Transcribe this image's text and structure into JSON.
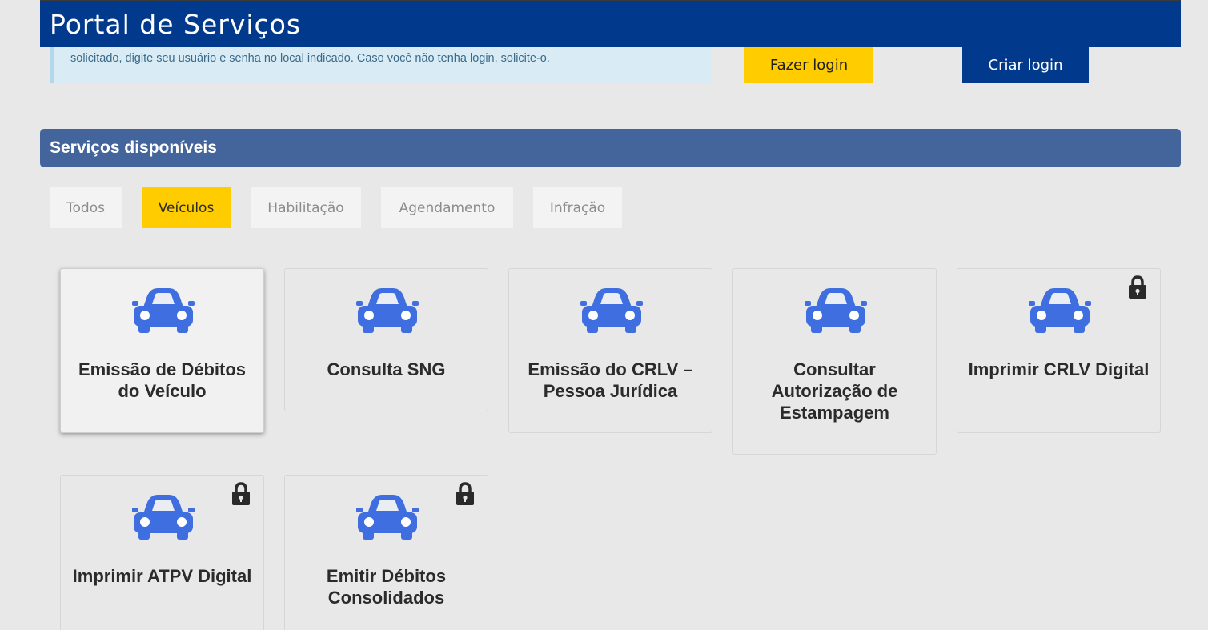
{
  "header": {
    "title": "Portal de Serviços"
  },
  "info": {
    "text": "solicitado, digite seu usuário e senha no local indicado. Caso você não tenha login, solicite-o."
  },
  "actions": {
    "login_label": "Fazer login",
    "create_label": "Criar login"
  },
  "section": {
    "title": "Serviços disponíveis"
  },
  "tabs": [
    {
      "label": "Todos"
    },
    {
      "label": "Veículos",
      "active": true
    },
    {
      "label": "Habilitação"
    },
    {
      "label": "Agendamento"
    },
    {
      "label": "Infração"
    }
  ],
  "cards": [
    {
      "title": "Emissão de Débitos do Veículo",
      "icon": "car-icon",
      "locked": false
    },
    {
      "title": "Consulta SNG",
      "icon": "car-icon",
      "locked": false
    },
    {
      "title": "Emissão do CRLV – Pessoa Jurídica",
      "icon": "car-icon",
      "locked": false
    },
    {
      "title": "Consultar Autorização de Estampagem",
      "icon": "car-icon",
      "locked": false
    },
    {
      "title": "Imprimir CRLV Digital",
      "icon": "car-icon",
      "locked": true
    },
    {
      "title": "Imprimir ATPV Digital",
      "icon": "car-icon",
      "locked": true
    },
    {
      "title": "Emitir Débitos Consolidados",
      "icon": "car-icon",
      "locked": true
    }
  ],
  "colors": {
    "header_bg": "#01398d",
    "accent_yellow": "#ffcc00",
    "section_bg": "#44659b",
    "icon_blue": "#3f6ee0",
    "info_bg": "#d9ecf5"
  }
}
